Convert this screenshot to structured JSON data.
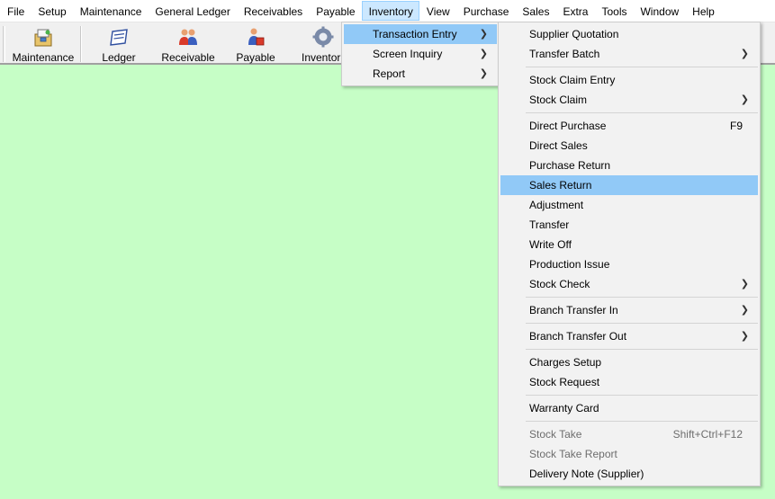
{
  "menubar": {
    "items": [
      "File",
      "Setup",
      "Maintenance",
      "General Ledger",
      "Receivables",
      "Payable",
      "Inventory",
      "View",
      "Purchase",
      "Sales",
      "Extra",
      "Tools",
      "Window",
      "Help"
    ]
  },
  "toolbar": {
    "buttons": [
      {
        "label": "Maintenance",
        "icon": "maintenance-icon"
      },
      {
        "label": "Ledger",
        "icon": "ledger-icon"
      },
      {
        "label": "Receivable",
        "icon": "receivable-icon"
      },
      {
        "label": "Payable",
        "icon": "payable-icon"
      },
      {
        "label": "Inventor",
        "icon": "inventory-gear-icon"
      }
    ]
  },
  "inventory_menu": {
    "items": [
      "Transaction Entry",
      "Screen Inquiry",
      "Report"
    ]
  },
  "transaction_menu": {
    "items": [
      {
        "label": "Supplier Quotation"
      },
      {
        "label": "Transfer Batch"
      },
      {
        "label": "Stock Claim Entry"
      },
      {
        "label": "Stock Claim"
      },
      {
        "label": "Direct Purchase",
        "shortcut": "F9"
      },
      {
        "label": "Direct Sales"
      },
      {
        "label": "Purchase Return"
      },
      {
        "label": "Sales Return"
      },
      {
        "label": "Adjustment"
      },
      {
        "label": "Transfer"
      },
      {
        "label": "Write Off"
      },
      {
        "label": "Production Issue"
      },
      {
        "label": "Stock Check"
      },
      {
        "label": "Branch Transfer In"
      },
      {
        "label": "Branch Transfer Out"
      },
      {
        "label": "Charges Setup"
      },
      {
        "label": "Stock Request"
      },
      {
        "label": "Warranty Card"
      },
      {
        "label": "Stock Take",
        "shortcut": "Shift+Ctrl+F12"
      },
      {
        "label": "Stock Take Report"
      },
      {
        "label": "Delivery Note (Supplier)"
      }
    ]
  },
  "colors": {
    "workspace": "#c6fec6",
    "highlight": "#91c9f7",
    "menubar_active": "#cce8ff"
  }
}
